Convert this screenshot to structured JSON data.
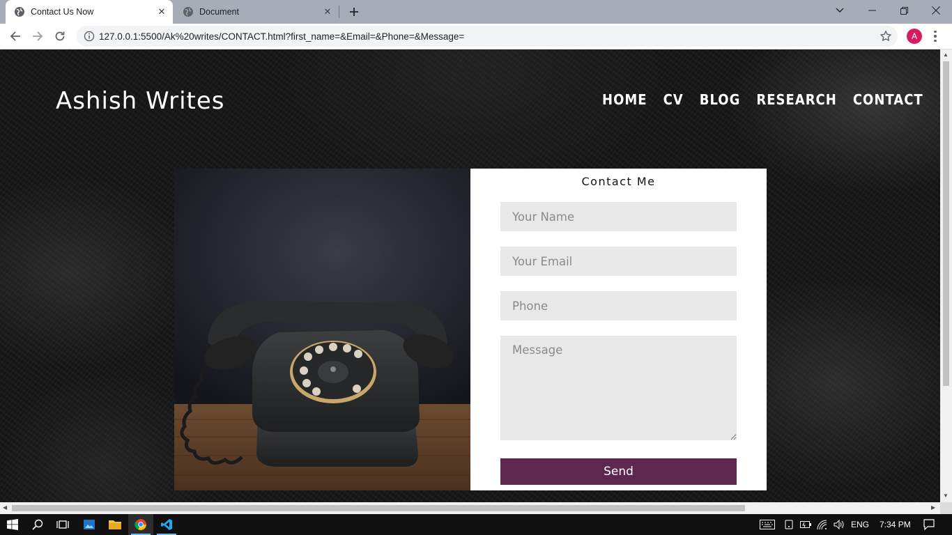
{
  "browser": {
    "tabs": [
      {
        "title": "Contact Us Now",
        "active": true
      },
      {
        "title": "Document",
        "active": false
      }
    ],
    "address_url": "127.0.0.1:5500/Ak%20writes/CONTACT.html?first_name=&Email=&Phone=&Message=",
    "profile_initial": "A"
  },
  "site": {
    "title": "Ashish Writes",
    "nav": [
      "HOME",
      "CV",
      "BLOG",
      "RESEARCH",
      "CONTACT"
    ]
  },
  "contact_form": {
    "title": "Contact Me",
    "name_placeholder": "Your Name",
    "email_placeholder": "Your Email",
    "phone_placeholder": "Phone",
    "message_placeholder": "Message",
    "send_label": "Send",
    "accent_color": "#5d2750"
  },
  "taskbar": {
    "language": "ENG",
    "time": "7:34 PM"
  }
}
